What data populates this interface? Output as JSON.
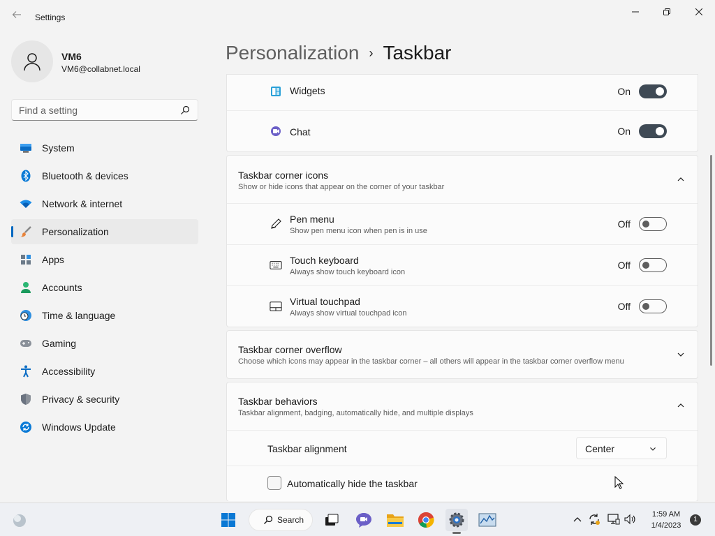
{
  "window": {
    "title": "Settings"
  },
  "profile": {
    "name": "VM6",
    "email": "VM6@collabnet.local"
  },
  "search": {
    "placeholder": "Find a setting"
  },
  "sidebar": {
    "items": [
      {
        "label": "System",
        "icon": "monitor-icon"
      },
      {
        "label": "Bluetooth & devices",
        "icon": "bluetooth-icon"
      },
      {
        "label": "Network & internet",
        "icon": "wifi-icon"
      },
      {
        "label": "Personalization",
        "icon": "brush-icon",
        "selected": true
      },
      {
        "label": "Apps",
        "icon": "apps-icon"
      },
      {
        "label": "Accounts",
        "icon": "person-icon"
      },
      {
        "label": "Time & language",
        "icon": "clock-globe-icon"
      },
      {
        "label": "Gaming",
        "icon": "gamepad-icon"
      },
      {
        "label": "Accessibility",
        "icon": "accessibility-icon"
      },
      {
        "label": "Privacy & security",
        "icon": "shield-icon"
      },
      {
        "label": "Windows Update",
        "icon": "update-icon"
      }
    ]
  },
  "breadcrumb": {
    "parent": "Personalization",
    "separator": "›",
    "current": "Taskbar"
  },
  "taskbar_items": {
    "widgets": {
      "label": "Widgets",
      "state": "On"
    },
    "chat": {
      "label": "Chat",
      "state": "On"
    }
  },
  "corner_icons": {
    "title": "Taskbar corner icons",
    "subtitle": "Show or hide icons that appear on the corner of your taskbar",
    "items": [
      {
        "title": "Pen menu",
        "subtitle": "Show pen menu icon when pen is in use",
        "state": "Off"
      },
      {
        "title": "Touch keyboard",
        "subtitle": "Always show touch keyboard icon",
        "state": "Off"
      },
      {
        "title": "Virtual touchpad",
        "subtitle": "Always show virtual touchpad icon",
        "state": "Off"
      }
    ]
  },
  "corner_overflow": {
    "title": "Taskbar corner overflow",
    "subtitle": "Choose which icons may appear in the taskbar corner – all others will appear in the taskbar corner overflow menu"
  },
  "behaviors": {
    "title": "Taskbar behaviors",
    "subtitle": "Taskbar alignment, badging, automatically hide, and multiple displays",
    "alignment_label": "Taskbar alignment",
    "alignment_value": "Center",
    "autohide_label": "Automatically hide the taskbar"
  },
  "taskbar": {
    "search_label": "Search",
    "time": "1:59 AM",
    "date": "1/4/2023",
    "notification_count": "1"
  },
  "colors": {
    "accent": "#0067c0",
    "toggle_on": "#3f4a55"
  }
}
